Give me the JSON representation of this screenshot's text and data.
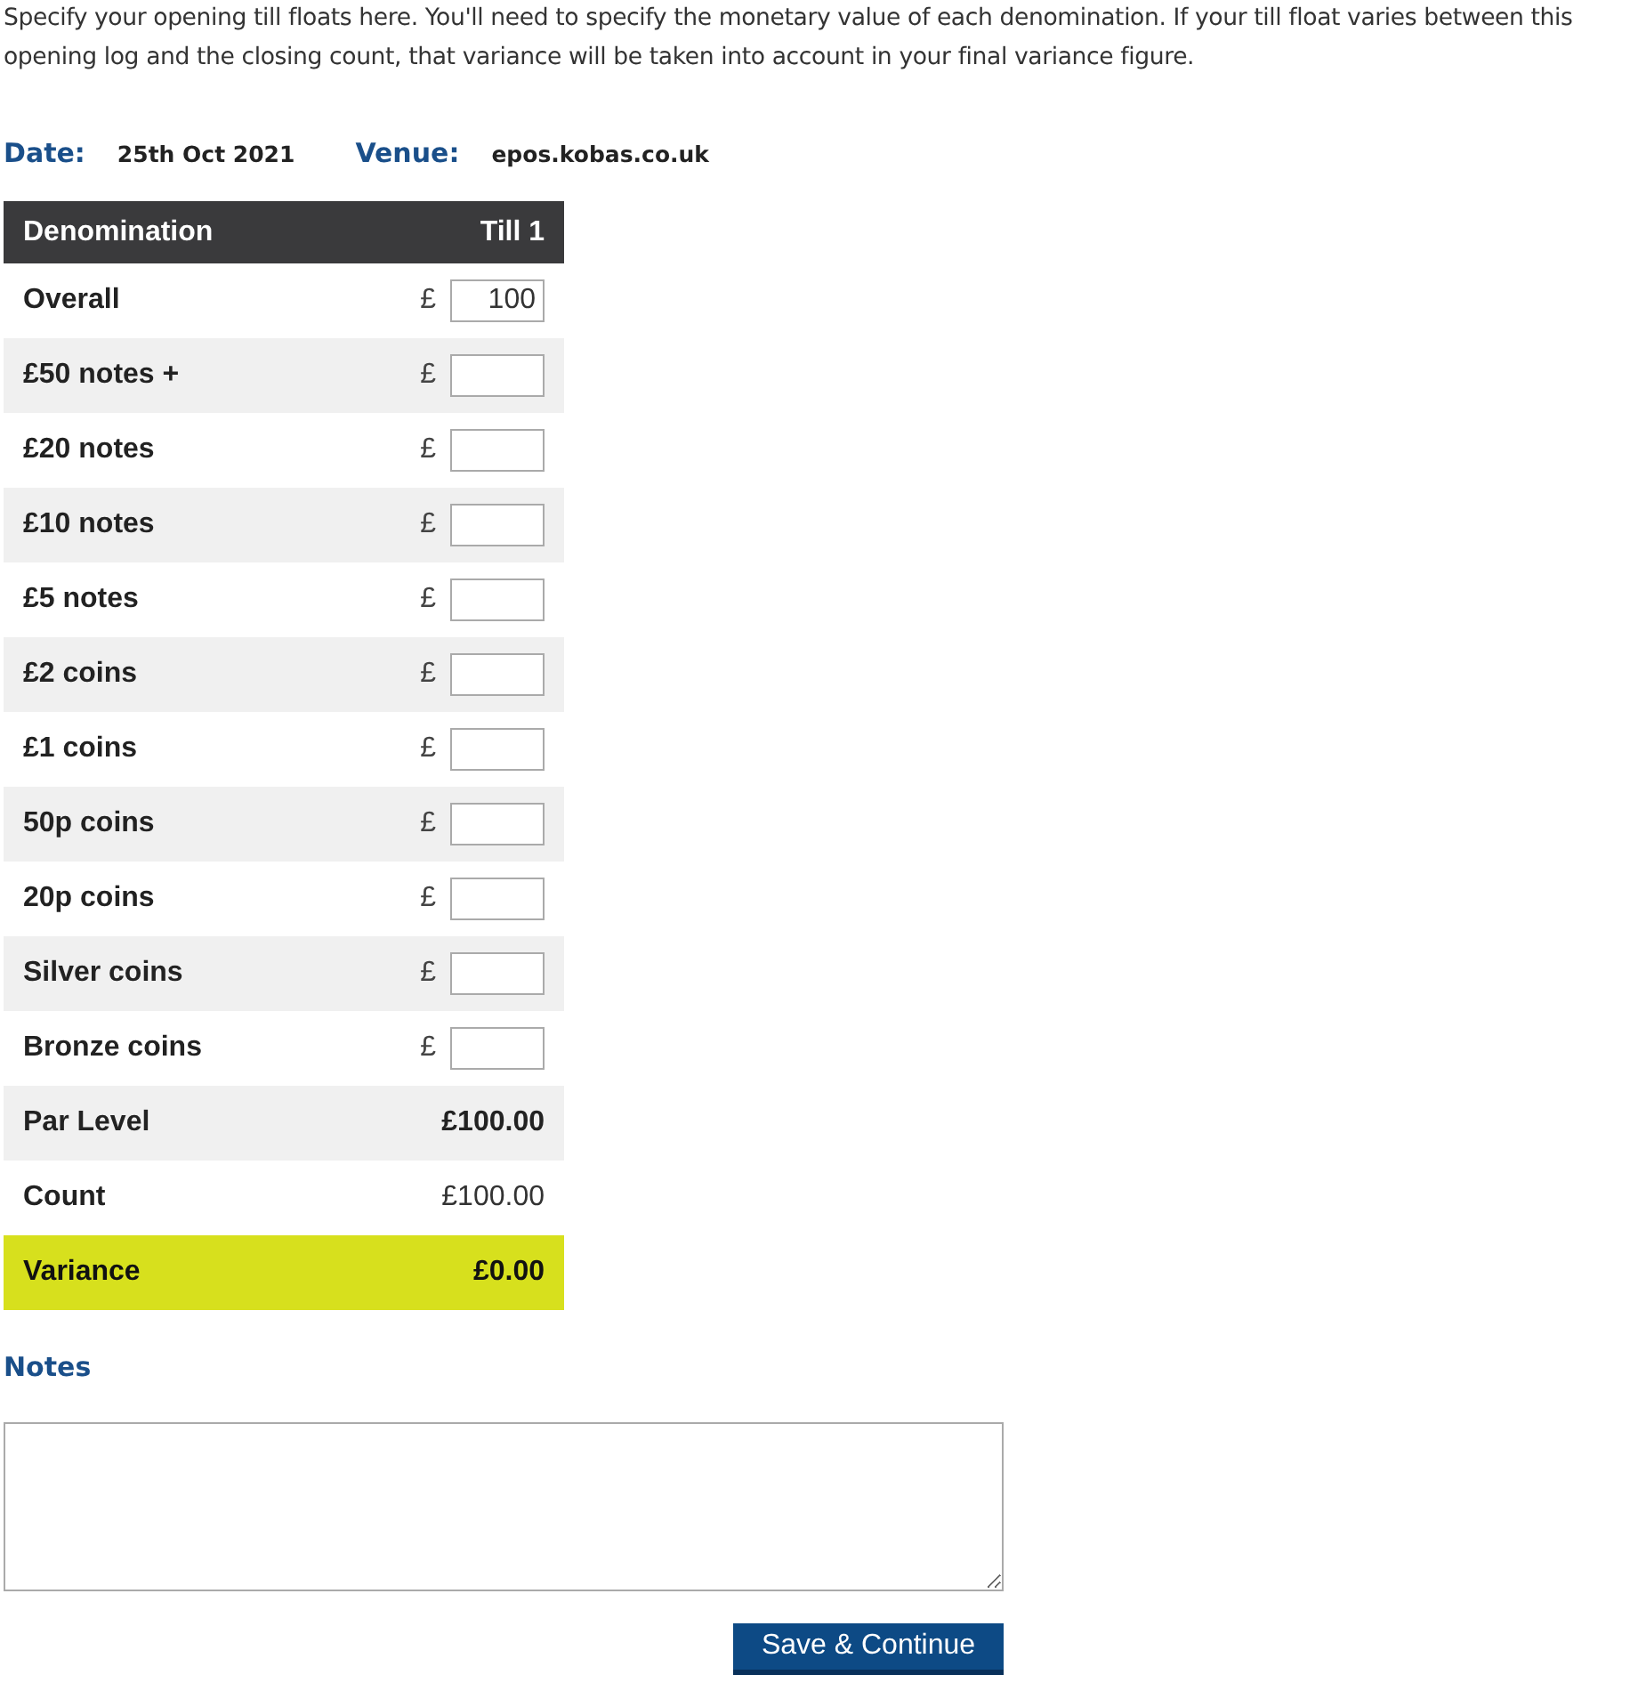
{
  "intro": "Specify your opening till floats here. You'll need to specify the monetary value of each denomination. If your till float varies between this opening log and the closing count, that variance will be taken into account in your final variance figure.",
  "meta": [
    {
      "label": "Date:",
      "value": "25th Oct 2021"
    },
    {
      "label": "Venue:",
      "value": "epos.kobas.co.uk"
    }
  ],
  "table": {
    "columns": [
      "Denomination",
      "Till 1"
    ],
    "rows": [
      {
        "kind": "input",
        "label": "Overall",
        "currency": "£",
        "value": "100"
      },
      {
        "kind": "input",
        "label": "£50 notes +",
        "currency": "£",
        "value": ""
      },
      {
        "kind": "input",
        "label": "£20 notes",
        "currency": "£",
        "value": ""
      },
      {
        "kind": "input",
        "label": "£10 notes",
        "currency": "£",
        "value": ""
      },
      {
        "kind": "input",
        "label": "£5 notes",
        "currency": "£",
        "value": ""
      },
      {
        "kind": "input",
        "label": "£2 coins",
        "currency": "£",
        "value": ""
      },
      {
        "kind": "input",
        "label": "£1 coins",
        "currency": "£",
        "value": ""
      },
      {
        "kind": "input",
        "label": "50p coins",
        "currency": "£",
        "value": ""
      },
      {
        "kind": "input",
        "label": "20p coins",
        "currency": "£",
        "value": ""
      },
      {
        "kind": "input",
        "label": "Silver coins",
        "currency": "£",
        "value": ""
      },
      {
        "kind": "input",
        "label": "Bronze coins",
        "currency": "£",
        "value": ""
      },
      {
        "kind": "bold",
        "label": "Par Level",
        "value": "£100.00"
      },
      {
        "kind": "plain",
        "label": "Count",
        "value": "£100.00"
      },
      {
        "kind": "variance",
        "label": "Variance",
        "value": "£0.00"
      }
    ]
  },
  "notes": {
    "label": "Notes"
  },
  "buttons": [
    "Save & Continue"
  ]
}
